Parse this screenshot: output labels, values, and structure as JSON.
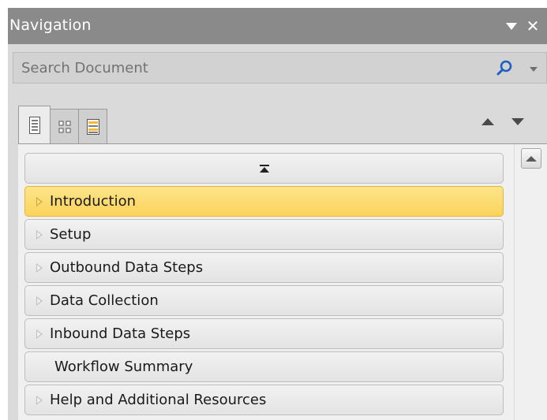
{
  "titlebar": {
    "title": "Navigation",
    "close_glyph": "✕"
  },
  "search": {
    "placeholder": "Search Document",
    "icon": "search-icon"
  },
  "tabs": [
    {
      "name": "headings",
      "icon": "page-list-icon",
      "active": true
    },
    {
      "name": "pages",
      "icon": "thumbnail-grid-icon",
      "active": false
    },
    {
      "name": "results",
      "icon": "search-results-icon",
      "active": false
    }
  ],
  "colors": {
    "titlebar_bg": "#8a8a8a",
    "selected_row": "#fbd35a",
    "row_bg": "#e9e9e9"
  },
  "nav_items": [
    {
      "label": "Introduction",
      "expandable": true,
      "selected": true
    },
    {
      "label": "Setup",
      "expandable": true,
      "selected": false
    },
    {
      "label": "Outbound Data Steps",
      "expandable": true,
      "selected": false
    },
    {
      "label": "Data Collection",
      "expandable": true,
      "selected": false
    },
    {
      "label": "Inbound Data Steps",
      "expandable": true,
      "selected": false
    },
    {
      "label": "Workflow Summary",
      "expandable": false,
      "selected": false
    },
    {
      "label": "Help and Additional Resources",
      "expandable": true,
      "selected": false
    }
  ]
}
